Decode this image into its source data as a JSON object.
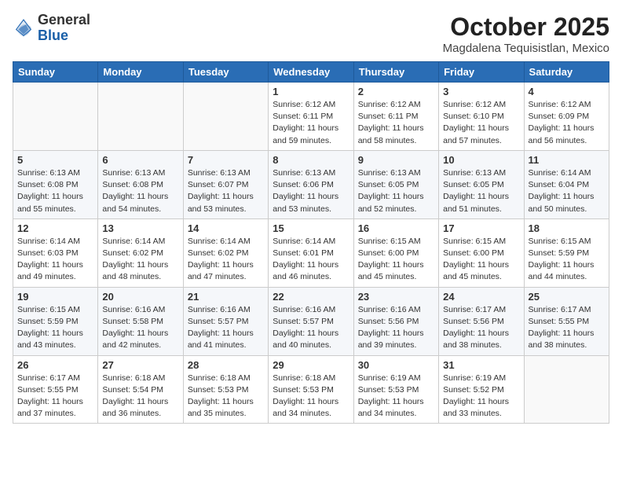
{
  "header": {
    "logo_general": "General",
    "logo_blue": "Blue",
    "month": "October 2025",
    "location": "Magdalena Tequisistlan, Mexico"
  },
  "weekdays": [
    "Sunday",
    "Monday",
    "Tuesday",
    "Wednesday",
    "Thursday",
    "Friday",
    "Saturday"
  ],
  "weeks": [
    [
      {
        "day": "",
        "sunrise": "",
        "sunset": "",
        "daylight": ""
      },
      {
        "day": "",
        "sunrise": "",
        "sunset": "",
        "daylight": ""
      },
      {
        "day": "",
        "sunrise": "",
        "sunset": "",
        "daylight": ""
      },
      {
        "day": "1",
        "sunrise": "Sunrise: 6:12 AM",
        "sunset": "Sunset: 6:11 PM",
        "daylight": "Daylight: 11 hours and 59 minutes."
      },
      {
        "day": "2",
        "sunrise": "Sunrise: 6:12 AM",
        "sunset": "Sunset: 6:11 PM",
        "daylight": "Daylight: 11 hours and 58 minutes."
      },
      {
        "day": "3",
        "sunrise": "Sunrise: 6:12 AM",
        "sunset": "Sunset: 6:10 PM",
        "daylight": "Daylight: 11 hours and 57 minutes."
      },
      {
        "day": "4",
        "sunrise": "Sunrise: 6:12 AM",
        "sunset": "Sunset: 6:09 PM",
        "daylight": "Daylight: 11 hours and 56 minutes."
      }
    ],
    [
      {
        "day": "5",
        "sunrise": "Sunrise: 6:13 AM",
        "sunset": "Sunset: 6:08 PM",
        "daylight": "Daylight: 11 hours and 55 minutes."
      },
      {
        "day": "6",
        "sunrise": "Sunrise: 6:13 AM",
        "sunset": "Sunset: 6:08 PM",
        "daylight": "Daylight: 11 hours and 54 minutes."
      },
      {
        "day": "7",
        "sunrise": "Sunrise: 6:13 AM",
        "sunset": "Sunset: 6:07 PM",
        "daylight": "Daylight: 11 hours and 53 minutes."
      },
      {
        "day": "8",
        "sunrise": "Sunrise: 6:13 AM",
        "sunset": "Sunset: 6:06 PM",
        "daylight": "Daylight: 11 hours and 53 minutes."
      },
      {
        "day": "9",
        "sunrise": "Sunrise: 6:13 AM",
        "sunset": "Sunset: 6:05 PM",
        "daylight": "Daylight: 11 hours and 52 minutes."
      },
      {
        "day": "10",
        "sunrise": "Sunrise: 6:13 AM",
        "sunset": "Sunset: 6:05 PM",
        "daylight": "Daylight: 11 hours and 51 minutes."
      },
      {
        "day": "11",
        "sunrise": "Sunrise: 6:14 AM",
        "sunset": "Sunset: 6:04 PM",
        "daylight": "Daylight: 11 hours and 50 minutes."
      }
    ],
    [
      {
        "day": "12",
        "sunrise": "Sunrise: 6:14 AM",
        "sunset": "Sunset: 6:03 PM",
        "daylight": "Daylight: 11 hours and 49 minutes."
      },
      {
        "day": "13",
        "sunrise": "Sunrise: 6:14 AM",
        "sunset": "Sunset: 6:02 PM",
        "daylight": "Daylight: 11 hours and 48 minutes."
      },
      {
        "day": "14",
        "sunrise": "Sunrise: 6:14 AM",
        "sunset": "Sunset: 6:02 PM",
        "daylight": "Daylight: 11 hours and 47 minutes."
      },
      {
        "day": "15",
        "sunrise": "Sunrise: 6:14 AM",
        "sunset": "Sunset: 6:01 PM",
        "daylight": "Daylight: 11 hours and 46 minutes."
      },
      {
        "day": "16",
        "sunrise": "Sunrise: 6:15 AM",
        "sunset": "Sunset: 6:00 PM",
        "daylight": "Daylight: 11 hours and 45 minutes."
      },
      {
        "day": "17",
        "sunrise": "Sunrise: 6:15 AM",
        "sunset": "Sunset: 6:00 PM",
        "daylight": "Daylight: 11 hours and 45 minutes."
      },
      {
        "day": "18",
        "sunrise": "Sunrise: 6:15 AM",
        "sunset": "Sunset: 5:59 PM",
        "daylight": "Daylight: 11 hours and 44 minutes."
      }
    ],
    [
      {
        "day": "19",
        "sunrise": "Sunrise: 6:15 AM",
        "sunset": "Sunset: 5:59 PM",
        "daylight": "Daylight: 11 hours and 43 minutes."
      },
      {
        "day": "20",
        "sunrise": "Sunrise: 6:16 AM",
        "sunset": "Sunset: 5:58 PM",
        "daylight": "Daylight: 11 hours and 42 minutes."
      },
      {
        "day": "21",
        "sunrise": "Sunrise: 6:16 AM",
        "sunset": "Sunset: 5:57 PM",
        "daylight": "Daylight: 11 hours and 41 minutes."
      },
      {
        "day": "22",
        "sunrise": "Sunrise: 6:16 AM",
        "sunset": "Sunset: 5:57 PM",
        "daylight": "Daylight: 11 hours and 40 minutes."
      },
      {
        "day": "23",
        "sunrise": "Sunrise: 6:16 AM",
        "sunset": "Sunset: 5:56 PM",
        "daylight": "Daylight: 11 hours and 39 minutes."
      },
      {
        "day": "24",
        "sunrise": "Sunrise: 6:17 AM",
        "sunset": "Sunset: 5:56 PM",
        "daylight": "Daylight: 11 hours and 38 minutes."
      },
      {
        "day": "25",
        "sunrise": "Sunrise: 6:17 AM",
        "sunset": "Sunset: 5:55 PM",
        "daylight": "Daylight: 11 hours and 38 minutes."
      }
    ],
    [
      {
        "day": "26",
        "sunrise": "Sunrise: 6:17 AM",
        "sunset": "Sunset: 5:55 PM",
        "daylight": "Daylight: 11 hours and 37 minutes."
      },
      {
        "day": "27",
        "sunrise": "Sunrise: 6:18 AM",
        "sunset": "Sunset: 5:54 PM",
        "daylight": "Daylight: 11 hours and 36 minutes."
      },
      {
        "day": "28",
        "sunrise": "Sunrise: 6:18 AM",
        "sunset": "Sunset: 5:53 PM",
        "daylight": "Daylight: 11 hours and 35 minutes."
      },
      {
        "day": "29",
        "sunrise": "Sunrise: 6:18 AM",
        "sunset": "Sunset: 5:53 PM",
        "daylight": "Daylight: 11 hours and 34 minutes."
      },
      {
        "day": "30",
        "sunrise": "Sunrise: 6:19 AM",
        "sunset": "Sunset: 5:53 PM",
        "daylight": "Daylight: 11 hours and 34 minutes."
      },
      {
        "day": "31",
        "sunrise": "Sunrise: 6:19 AM",
        "sunset": "Sunset: 5:52 PM",
        "daylight": "Daylight: 11 hours and 33 minutes."
      },
      {
        "day": "",
        "sunrise": "",
        "sunset": "",
        "daylight": ""
      }
    ]
  ]
}
